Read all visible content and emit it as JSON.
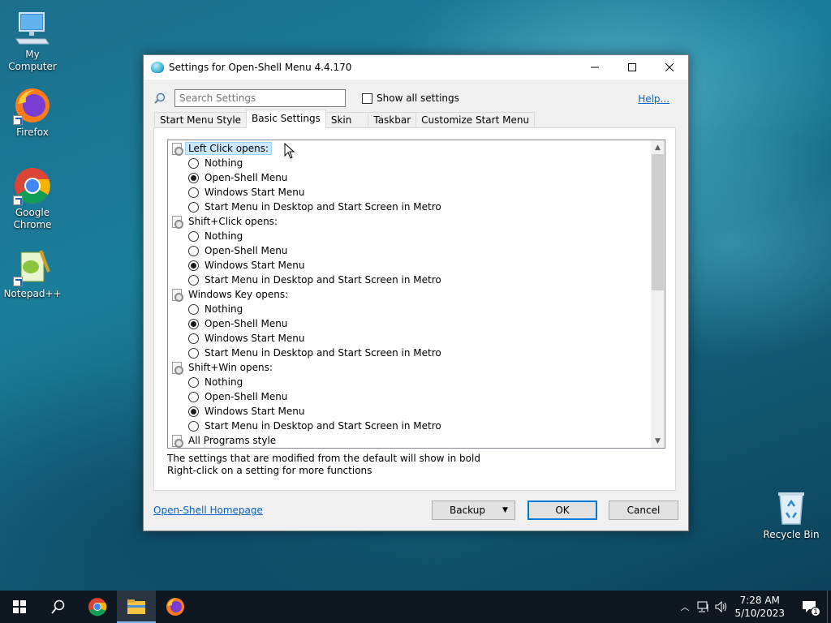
{
  "desktop": {
    "icons": [
      {
        "label": "My Computer"
      },
      {
        "label": "Firefox"
      },
      {
        "label": "Google Chrome"
      },
      {
        "label": "Notepad++"
      },
      {
        "label": "Recycle Bin"
      }
    ]
  },
  "window": {
    "title": "Settings for Open-Shell Menu 4.4.170",
    "search_placeholder": "Search Settings",
    "show_all_label": "Show all settings",
    "help_label": "Help...",
    "tabs": [
      {
        "label": "Start Menu Style"
      },
      {
        "label": "Basic Settings"
      },
      {
        "label": "Skin"
      },
      {
        "label": "Taskbar"
      },
      {
        "label": "Customize Start Menu"
      }
    ],
    "groups": [
      {
        "label": "Left Click opens:",
        "options": [
          "Nothing",
          "Open-Shell Menu",
          "Windows Start Menu",
          "Start Menu in Desktop and Start Screen in Metro"
        ],
        "selected": "Open-Shell Menu"
      },
      {
        "label": "Shift+Click opens:",
        "options": [
          "Nothing",
          "Open-Shell Menu",
          "Windows Start Menu",
          "Start Menu in Desktop and Start Screen in Metro"
        ],
        "selected": "Windows Start Menu"
      },
      {
        "label": "Windows Key opens:",
        "options": [
          "Nothing",
          "Open-Shell Menu",
          "Windows Start Menu",
          "Start Menu in Desktop and Start Screen in Metro"
        ],
        "selected": "Open-Shell Menu"
      },
      {
        "label": "Shift+Win opens:",
        "options": [
          "Nothing",
          "Open-Shell Menu",
          "Windows Start Menu",
          "Start Menu in Desktop and Start Screen in Metro"
        ],
        "selected": "Windows Start Menu"
      },
      {
        "label": "All Programs style",
        "options": []
      }
    ],
    "note1": "The settings that are modified from the default will show in bold",
    "note2": "Right-click on a setting for more functions",
    "homepage_label": "Open-Shell Homepage",
    "backup_label": "Backup",
    "ok_label": "OK",
    "cancel_label": "Cancel"
  },
  "taskbar": {
    "time": "7:28 AM",
    "date": "5/10/2023",
    "notification_count": "1"
  }
}
